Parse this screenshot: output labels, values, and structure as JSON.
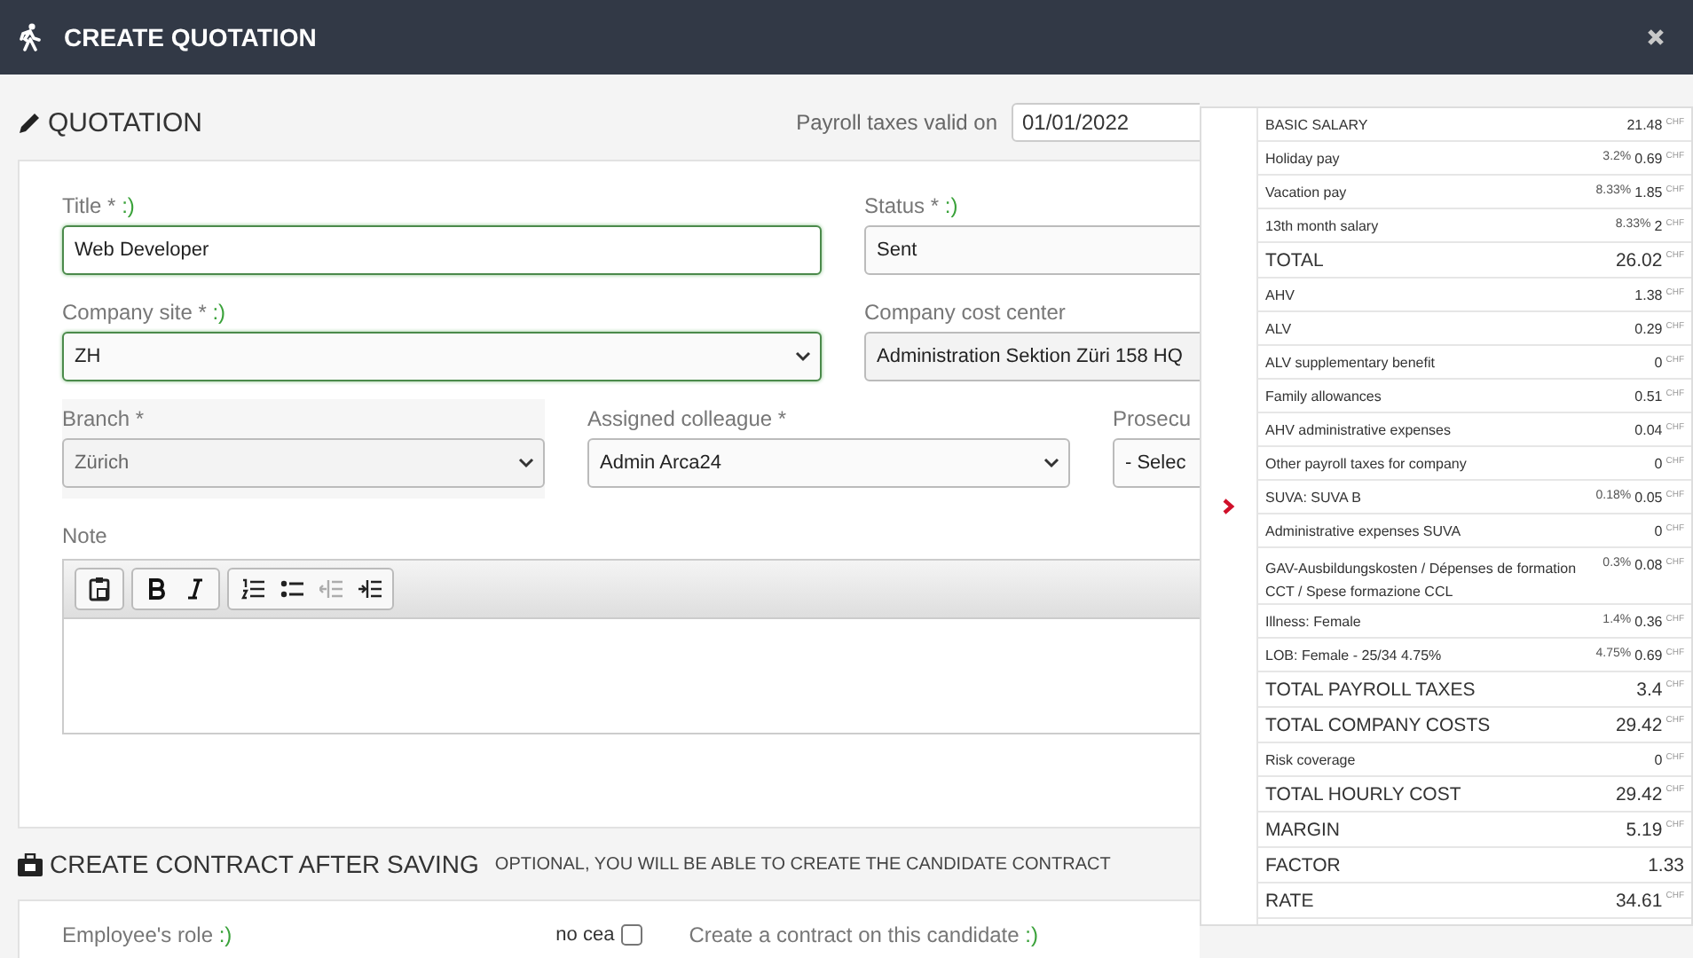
{
  "window": {
    "title": "CREATE QUOTATION"
  },
  "quotation": {
    "heading": "QUOTATION",
    "payroll_label": "Payroll taxes valid on",
    "payroll_date": "01/01/2022",
    "fields": [
      {
        "kind": "input",
        "label": "Title *",
        "smiley": ":)",
        "value": "Web Developer",
        "valid": true,
        "disabled": false
      },
      {
        "kind": "select",
        "label": "Status *",
        "smiley": ":)",
        "value": "Sent",
        "valid": false,
        "disabled": false
      },
      {
        "kind": "select",
        "label": "Company site *",
        "smiley": ":)",
        "value": "ZH",
        "valid": true,
        "disabled": false
      },
      {
        "kind": "input",
        "label": "Company cost center",
        "value": "Administration Sektion Züri 158 HQ",
        "valid": false,
        "disabled": true
      },
      {
        "kind": "select",
        "label": "Branch *",
        "value": "Zürich",
        "valid": false,
        "disabled": true
      },
      {
        "kind": "select",
        "label": "Assigned colleague *",
        "value": "Admin Arca24",
        "valid": false,
        "disabled": false
      },
      {
        "kind": "select",
        "label": "Prosecu",
        "value": "- Selec",
        "valid": false,
        "disabled": false
      }
    ],
    "note": {
      "label": "Note",
      "tools": [
        {
          "kind": "paste",
          "disabled": false
        },
        {
          "kind": "bold",
          "disabled": false
        },
        {
          "kind": "italic",
          "disabled": false
        },
        {
          "kind": "ordered",
          "disabled": false
        },
        {
          "kind": "bullets",
          "disabled": false
        },
        {
          "kind": "outdent",
          "disabled": true
        },
        {
          "kind": "indent",
          "disabled": false
        }
      ]
    }
  },
  "contract": {
    "heading": "CREATE CONTRACT AFTER SAVING",
    "subheading": "OPTIONAL, YOU WILL BE ABLE TO CREATE THE CANDIDATE CONTRACT",
    "role_label": "Employee's role",
    "role_smiley": ":)",
    "checkbox_label": "no cea",
    "checkbox_checked": false,
    "create_label": "Create a contract on this candidate",
    "create_smiley": ":)"
  },
  "costs": {
    "rows": [
      {
        "kind": "item",
        "label": "BASIC SALARY",
        "value": "21.48",
        "unit": "CHF"
      },
      {
        "kind": "item",
        "label": "Holiday pay",
        "percent": "3.2%",
        "value": "0.69",
        "unit": "CHF"
      },
      {
        "kind": "item",
        "label": "Vacation pay",
        "percent": "8.33%",
        "value": "1.85",
        "unit": "CHF"
      },
      {
        "kind": "item",
        "label": "13th month salary",
        "percent": "8.33%",
        "value": "2",
        "unit": "CHF"
      },
      {
        "kind": "total",
        "label": "TOTAL",
        "value": "26.02",
        "unit": "CHF"
      },
      {
        "kind": "item",
        "label": "AHV",
        "value": "1.38",
        "unit": "CHF"
      },
      {
        "kind": "item",
        "label": "ALV",
        "value": "0.29",
        "unit": "CHF"
      },
      {
        "kind": "item",
        "label": "ALV supplementary benefit",
        "value": "0",
        "unit": "CHF"
      },
      {
        "kind": "item",
        "label": "Family allowances",
        "value": "0.51",
        "unit": "CHF"
      },
      {
        "kind": "item",
        "label": "AHV administrative expenses",
        "value": "0.04",
        "unit": "CHF"
      },
      {
        "kind": "item",
        "label": "Other payroll taxes for company",
        "value": "0",
        "unit": "CHF"
      },
      {
        "kind": "item",
        "label": "SUVA: SUVA B",
        "percent": "0.18%",
        "value": "0.05",
        "unit": "CHF"
      },
      {
        "kind": "item",
        "label": "Administrative expenses SUVA",
        "value": "0",
        "unit": "CHF"
      },
      {
        "kind": "item",
        "label": "GAV-Ausbildungskosten / Dépenses de formation CCT / Spese formazione CCL",
        "percent": "0.3%",
        "value": "0.08",
        "unit": "CHF"
      },
      {
        "kind": "item",
        "label": "Illness: Female",
        "percent": "1.4%",
        "value": "0.36",
        "unit": "CHF"
      },
      {
        "kind": "item",
        "label": "LOB: Female - 25/34 4.75%",
        "percent": "4.75%",
        "value": "0.69",
        "unit": "CHF"
      },
      {
        "kind": "total",
        "label": "TOTAL PAYROLL TAXES",
        "value": "3.4",
        "unit": "CHF"
      },
      {
        "kind": "total",
        "label": "TOTAL COMPANY COSTS",
        "value": "29.42",
        "unit": "CHF"
      },
      {
        "kind": "item",
        "label": "Risk coverage",
        "value": "0",
        "unit": "CHF"
      },
      {
        "kind": "total",
        "label": "TOTAL HOURLY COST",
        "value": "29.42",
        "unit": "CHF"
      },
      {
        "kind": "total",
        "label": "MARGIN",
        "value": "5.19",
        "unit": "CHF"
      },
      {
        "kind": "total",
        "label": "FACTOR",
        "value": "1.33"
      },
      {
        "kind": "total",
        "label": "RATE",
        "value": "34.61",
        "unit": "CHF"
      }
    ]
  }
}
